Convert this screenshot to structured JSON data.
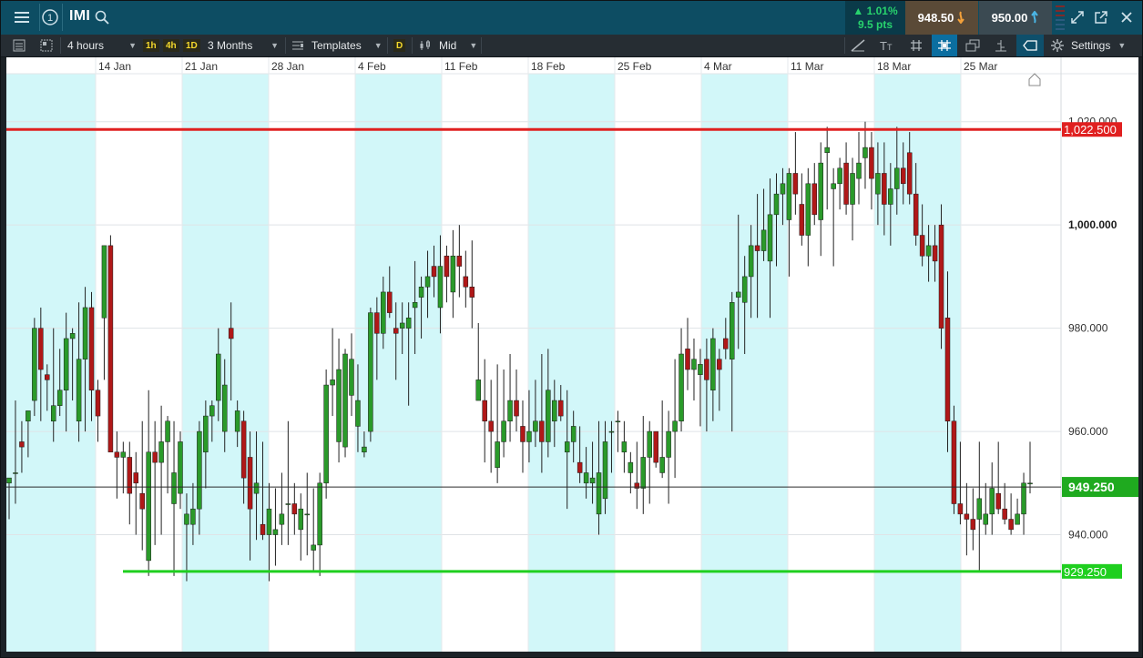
{
  "topbar": {
    "symbol": "IMI",
    "change_pct": "1.01%",
    "change_pts": "9.5 pts",
    "sell_price": "948.50",
    "buy_price": "950.00",
    "icons": [
      "menu-icon",
      "info-circle-icon",
      "search-icon",
      "expand-icon",
      "popout-icon",
      "close-icon"
    ]
  },
  "toolbar": {
    "interval": "4 hours",
    "quick_intervals": [
      "1h",
      "4h",
      "1D"
    ],
    "range": "3 Months",
    "templates_label": "Templates",
    "drawing_badge": "D",
    "price_type": "Mid",
    "settings_label": "Settings"
  },
  "chart_data": {
    "type": "candlestick",
    "x_dates": [
      "14 Jan",
      "21 Jan",
      "28 Jan",
      "4 Feb",
      "11 Feb",
      "18 Feb",
      "25 Feb",
      "4 Mar",
      "11 Mar",
      "18 Mar",
      "25 Mar"
    ],
    "y_ticks": [
      "1,020.000",
      "1,000.000",
      "980.000",
      "960.000",
      "940.000"
    ],
    "y_range": [
      920,
      1030
    ],
    "horizontal_lines": [
      {
        "label": "1,022.500",
        "value": 1018.5,
        "color": "#e02020"
      },
      {
        "label": "949.250",
        "value": 949.25,
        "color": "#1faa1f",
        "current": true
      },
      {
        "label": "929.250",
        "value": 932.9,
        "color": "#1fcf1f"
      }
    ],
    "shaded_weeks_color": "#d2f7f9",
    "up_color": "#2a9a2a",
    "down_color": "#b01818",
    "candles": [
      [
        950,
        950,
        943,
        951
      ],
      [
        952,
        966,
        946,
        952
      ],
      [
        958,
        962,
        952,
        957
      ],
      [
        962,
        964,
        955,
        964
      ],
      [
        966,
        982,
        963,
        980
      ],
      [
        980,
        984,
        962,
        972
      ],
      [
        971,
        973,
        964,
        970
      ],
      [
        962,
        980,
        958,
        965
      ],
      [
        965,
        976,
        963,
        968
      ],
      [
        968,
        983,
        960,
        978
      ],
      [
        978,
        980,
        966,
        979
      ],
      [
        962,
        985,
        958,
        974
      ],
      [
        974,
        988,
        960,
        984
      ],
      [
        984,
        987,
        962,
        968
      ],
      [
        968,
        970,
        958,
        963
      ],
      [
        982,
        996,
        970,
        996
      ],
      [
        996,
        998,
        960,
        956
      ],
      [
        956,
        960,
        947,
        955
      ],
      [
        955,
        958,
        948,
        956
      ],
      [
        955,
        958,
        942,
        948
      ],
      [
        952,
        956,
        940,
        950
      ],
      [
        948,
        962,
        937,
        945
      ],
      [
        935,
        968,
        932,
        956
      ],
      [
        956,
        962,
        938,
        954
      ],
      [
        954,
        965,
        940,
        958
      ],
      [
        958,
        963,
        948,
        962
      ],
      [
        946,
        962,
        932,
        952
      ],
      [
        948,
        960,
        945,
        958
      ],
      [
        942,
        948,
        931,
        944
      ],
      [
        942,
        950,
        938,
        945
      ],
      [
        945,
        962,
        940,
        960
      ],
      [
        956,
        966,
        949,
        963
      ],
      [
        963,
        966,
        958,
        965
      ],
      [
        966,
        980,
        962,
        975
      ],
      [
        960,
        974,
        956,
        969
      ],
      [
        980,
        985,
        966,
        978
      ],
      [
        960,
        966,
        957,
        964
      ],
      [
        962,
        964,
        946,
        951
      ],
      [
        955,
        960,
        935,
        945
      ],
      [
        948,
        960,
        939,
        950
      ],
      [
        942,
        958,
        939,
        940
      ],
      [
        940,
        950,
        931,
        945
      ],
      [
        940,
        949,
        934,
        941
      ],
      [
        942,
        952,
        938,
        944
      ],
      [
        946,
        962,
        938,
        946
      ],
      [
        946,
        950,
        940,
        944
      ],
      [
        941,
        948,
        935,
        945
      ],
      [
        944,
        952,
        936,
        944
      ],
      [
        937,
        949,
        933,
        938
      ],
      [
        938,
        952,
        932,
        950
      ],
      [
        950,
        972,
        947,
        969
      ],
      [
        969,
        980,
        963,
        970
      ],
      [
        958,
        978,
        954,
        972
      ],
      [
        957,
        976,
        955,
        975
      ],
      [
        967,
        979,
        963,
        974
      ],
      [
        961,
        973,
        956,
        966
      ],
      [
        956,
        960,
        955,
        957
      ],
      [
        960,
        984,
        958,
        983
      ],
      [
        983,
        986,
        970,
        979
      ],
      [
        979,
        990,
        976,
        987
      ],
      [
        987,
        992,
        982,
        983
      ],
      [
        980,
        985,
        970,
        979
      ],
      [
        980,
        985,
        975,
        981
      ],
      [
        980,
        985,
        965,
        982
      ],
      [
        984,
        993,
        975,
        985
      ],
      [
        986,
        990,
        978,
        988
      ],
      [
        988,
        995,
        982,
        990
      ],
      [
        992,
        996,
        986,
        990
      ],
      [
        984,
        998,
        979,
        992
      ],
      [
        994,
        996,
        985,
        990
      ],
      [
        987,
        999,
        982,
        994
      ],
      [
        994,
        1000,
        986,
        992
      ],
      [
        990,
        995,
        984,
        988
      ],
      [
        988,
        997,
        980,
        986
      ],
      [
        966,
        981,
        967,
        970
      ],
      [
        966,
        974,
        954,
        962
      ],
      [
        962,
        970,
        952,
        960
      ],
      [
        953,
        973,
        950,
        958
      ],
      [
        958,
        972,
        955,
        962
      ],
      [
        962,
        975,
        958,
        966
      ],
      [
        966,
        972,
        960,
        963
      ],
      [
        961,
        966,
        952,
        958
      ],
      [
        958,
        968,
        954,
        960
      ],
      [
        960,
        970,
        957,
        962
      ],
      [
        962,
        975,
        952,
        958
      ],
      [
        958,
        976,
        955,
        968
      ],
      [
        962,
        970,
        957,
        966
      ],
      [
        966,
        969,
        962,
        963
      ],
      [
        956,
        968,
        945,
        958
      ],
      [
        958,
        964,
        954,
        961
      ],
      [
        954,
        961,
        950,
        952
      ],
      [
        950,
        957,
        947,
        952
      ],
      [
        950,
        958,
        946,
        951
      ],
      [
        944,
        962,
        940,
        952
      ],
      [
        947,
        962,
        944,
        958
      ],
      [
        960,
        962,
        952,
        960
      ],
      [
        962,
        964,
        956,
        962
      ],
      [
        956,
        962,
        952,
        958
      ],
      [
        952,
        956,
        948,
        954
      ],
      [
        950,
        958,
        945,
        949
      ],
      [
        949,
        963,
        944,
        955
      ],
      [
        955,
        962,
        946,
        960
      ],
      [
        960,
        960,
        953,
        954
      ],
      [
        952,
        966,
        951,
        955
      ],
      [
        955,
        964,
        946,
        960
      ],
      [
        960,
        974,
        951,
        962
      ],
      [
        962,
        980,
        960,
        975
      ],
      [
        976,
        982,
        968,
        972
      ],
      [
        972,
        978,
        966,
        974
      ],
      [
        971,
        976,
        961,
        973
      ],
      [
        974,
        978,
        960,
        970
      ],
      [
        968,
        980,
        962,
        978
      ],
      [
        974,
        976,
        964,
        972
      ],
      [
        978,
        982,
        974,
        976
      ],
      [
        974,
        987,
        960,
        985
      ],
      [
        986,
        1002,
        976,
        987
      ],
      [
        985,
        994,
        975,
        990
      ],
      [
        990,
        1000,
        982,
        996
      ],
      [
        996,
        1006,
        982,
        995
      ],
      [
        995,
        1007,
        993,
        999
      ],
      [
        993,
        1009,
        982,
        1002
      ],
      [
        1002,
        1010,
        992,
        1006
      ],
      [
        1006,
        1011,
        1000,
        1008
      ],
      [
        1001,
        1011,
        990,
        1010
      ],
      [
        1010,
        1018,
        1002,
        1006
      ],
      [
        1004,
        1010,
        996,
        998
      ],
      [
        998,
        1011,
        992,
        1008
      ],
      [
        1008,
        1012,
        1000,
        1002
      ],
      [
        1001,
        1016,
        994,
        1012
      ],
      [
        1014,
        1019,
        1003,
        1015
      ],
      [
        1007,
        1011,
        992,
        1008
      ],
      [
        1008,
        1013,
        1003,
        1011
      ],
      [
        1012,
        1016,
        1002,
        1004
      ],
      [
        1004,
        1013,
        997,
        1010
      ],
      [
        1009,
        1018,
        1004,
        1012
      ],
      [
        1013,
        1020,
        1007,
        1015
      ],
      [
        1015,
        1018,
        1003,
        1009
      ],
      [
        1006,
        1016,
        1000,
        1010
      ],
      [
        1010,
        1016,
        998,
        1004
      ],
      [
        1004,
        1012,
        996,
        1007
      ],
      [
        1007,
        1019,
        1002,
        1011
      ],
      [
        1011,
        1016,
        1004,
        1008
      ],
      [
        1014,
        1018,
        1004,
        1006
      ],
      [
        1006,
        1012,
        996,
        998
      ],
      [
        998,
        1004,
        992,
        994
      ],
      [
        994,
        1000,
        989,
        996
      ],
      [
        996,
        1000,
        989,
        993
      ],
      [
        1000,
        1004,
        976,
        980
      ],
      [
        982,
        991,
        956,
        962
      ],
      [
        962,
        965,
        944,
        946
      ],
      [
        946,
        958,
        942,
        944
      ],
      [
        944,
        950,
        936,
        943
      ],
      [
        943,
        949,
        937,
        941
      ],
      [
        943,
        958,
        933,
        947
      ],
      [
        942,
        950,
        940,
        944
      ],
      [
        944,
        954,
        940,
        949
      ],
      [
        948,
        958,
        944,
        945
      ],
      [
        945,
        950,
        942,
        943
      ],
      [
        943,
        948,
        940,
        941
      ],
      [
        942,
        947,
        943,
        944
      ],
      [
        944,
        952,
        940,
        950
      ],
      [
        950,
        958,
        948,
        950
      ]
    ]
  }
}
